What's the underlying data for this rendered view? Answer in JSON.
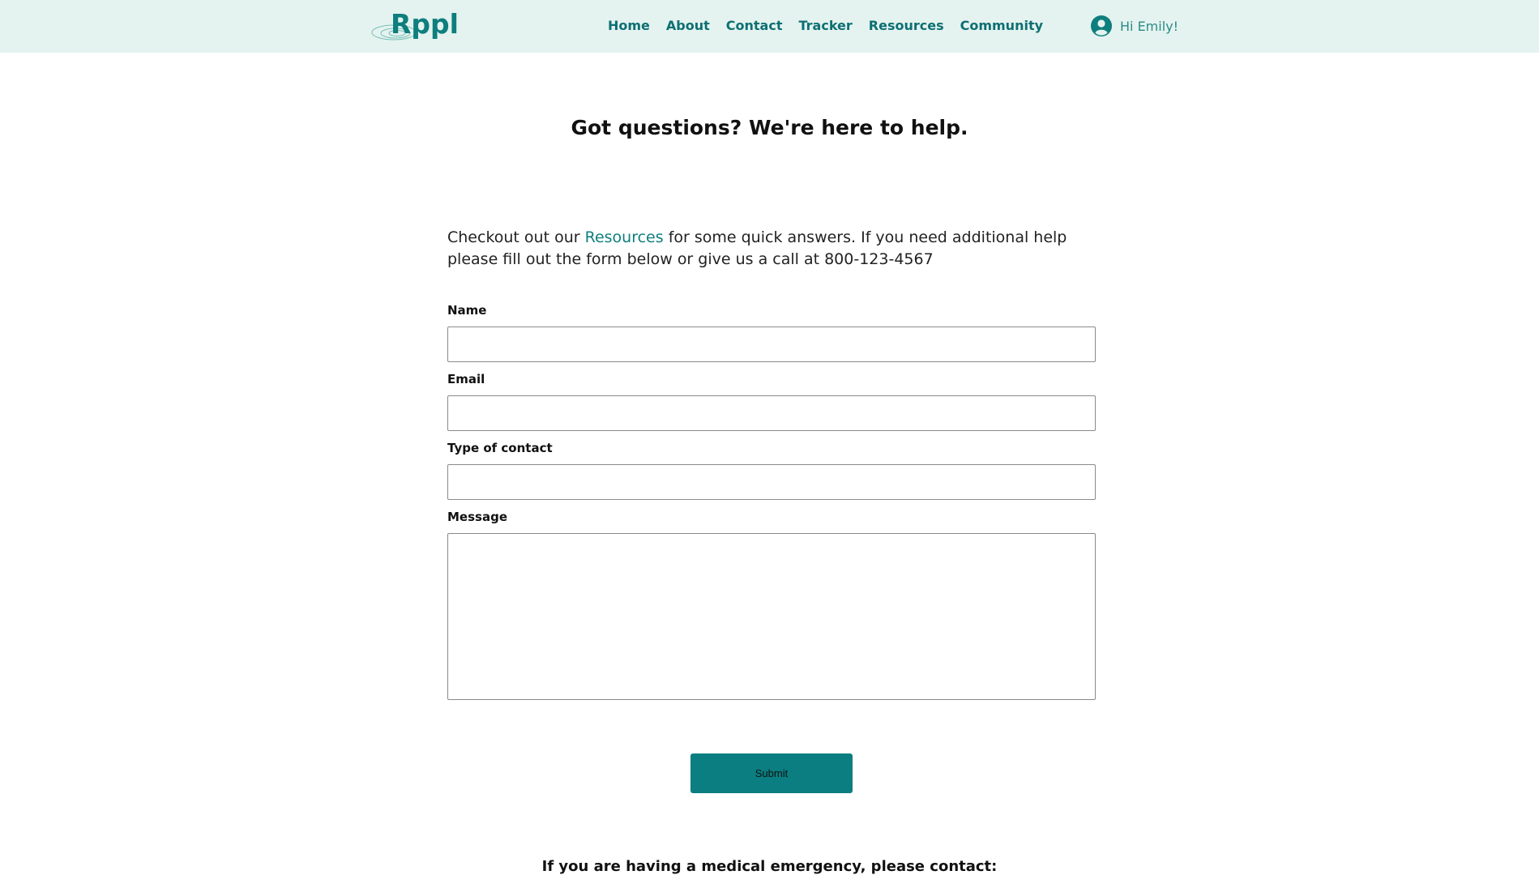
{
  "brand": {
    "name": "Rppl",
    "color": "#0e7e7e"
  },
  "nav": {
    "links": [
      "Home",
      "About",
      "Contact",
      "Tracker",
      "Resources",
      "Community"
    ]
  },
  "user": {
    "icon": "user-circle-icon",
    "greeting": "Hi Emily!"
  },
  "page": {
    "title": "Got questions? We're here to help.",
    "intro": {
      "before": "Checkout out our ",
      "link": "Resources",
      "after": " for some quick answers. If you need additional help please fill out the form below or give us a call at 800-123-4567"
    }
  },
  "form": {
    "name_label": "Name",
    "email_label": "Email",
    "type_label": "Type of contact",
    "message_label": "Message",
    "name_value": "",
    "email_value": "",
    "type_value": "",
    "message_value": "",
    "submit_label": "Submit"
  },
  "footer": {
    "emergency": "If you are having a medical emergency, please contact:"
  },
  "colors": {
    "navbar_bg": "#e4f3ef",
    "accent": "#0a7e80",
    "link": "#0e6f73"
  }
}
